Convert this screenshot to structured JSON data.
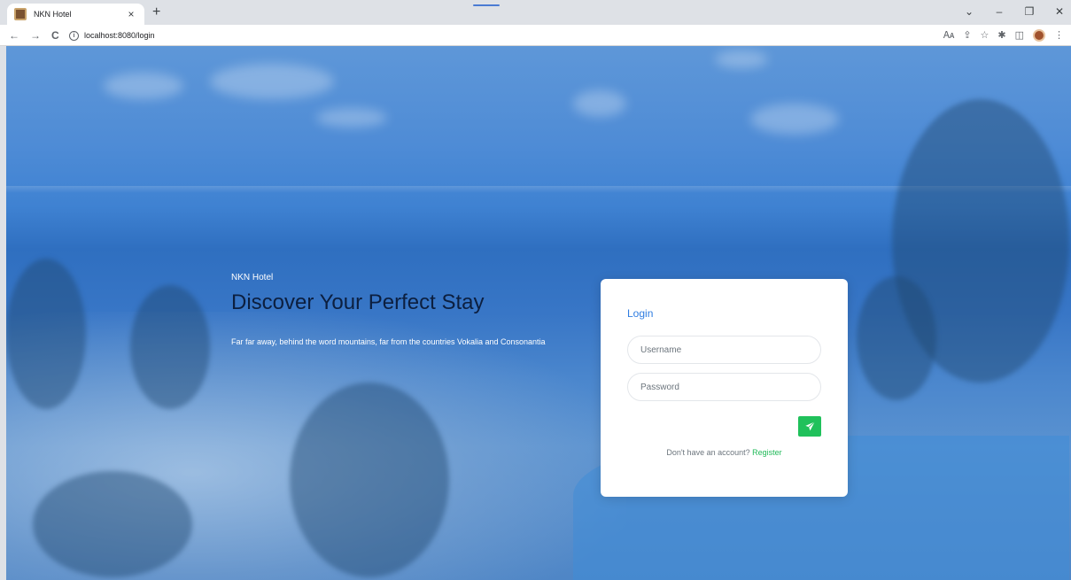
{
  "browser": {
    "tab_title": "NKN Hotel",
    "tab_close": "×",
    "new_tab": "+",
    "url": "localhost:8080/login",
    "nav": {
      "back": "←",
      "forward": "→",
      "reload": "C"
    },
    "window": {
      "dropdown": "⌄",
      "minimize": "–",
      "restore": "❐",
      "close": "✕"
    },
    "icons": [
      "translate-icon",
      "share-icon",
      "star-icon",
      "extensions-icon",
      "sidebar-icon",
      "profile-icon",
      "menu-icon"
    ],
    "ext_glyphs": {
      "translate": "🗛",
      "share": "⇪",
      "star": "☆",
      "extensions": "✱",
      "sidebar": "◫",
      "menu": "⋮"
    }
  },
  "hero": {
    "brand": "NKN Hotel",
    "title": "Discover Your Perfect Stay",
    "subtitle": "Far far away, behind the word mountains, far from the countries Vokalia and Consonantia"
  },
  "login": {
    "heading": "Login",
    "username_placeholder": "Username",
    "password_placeholder": "Password",
    "no_account_text": "Don't have an account?",
    "register_link": "Register"
  },
  "colors": {
    "accent_blue": "#2f7de1",
    "submit_green": "#20c15b",
    "register_green": "#20b958",
    "hero_title": "#0c1f3f"
  }
}
